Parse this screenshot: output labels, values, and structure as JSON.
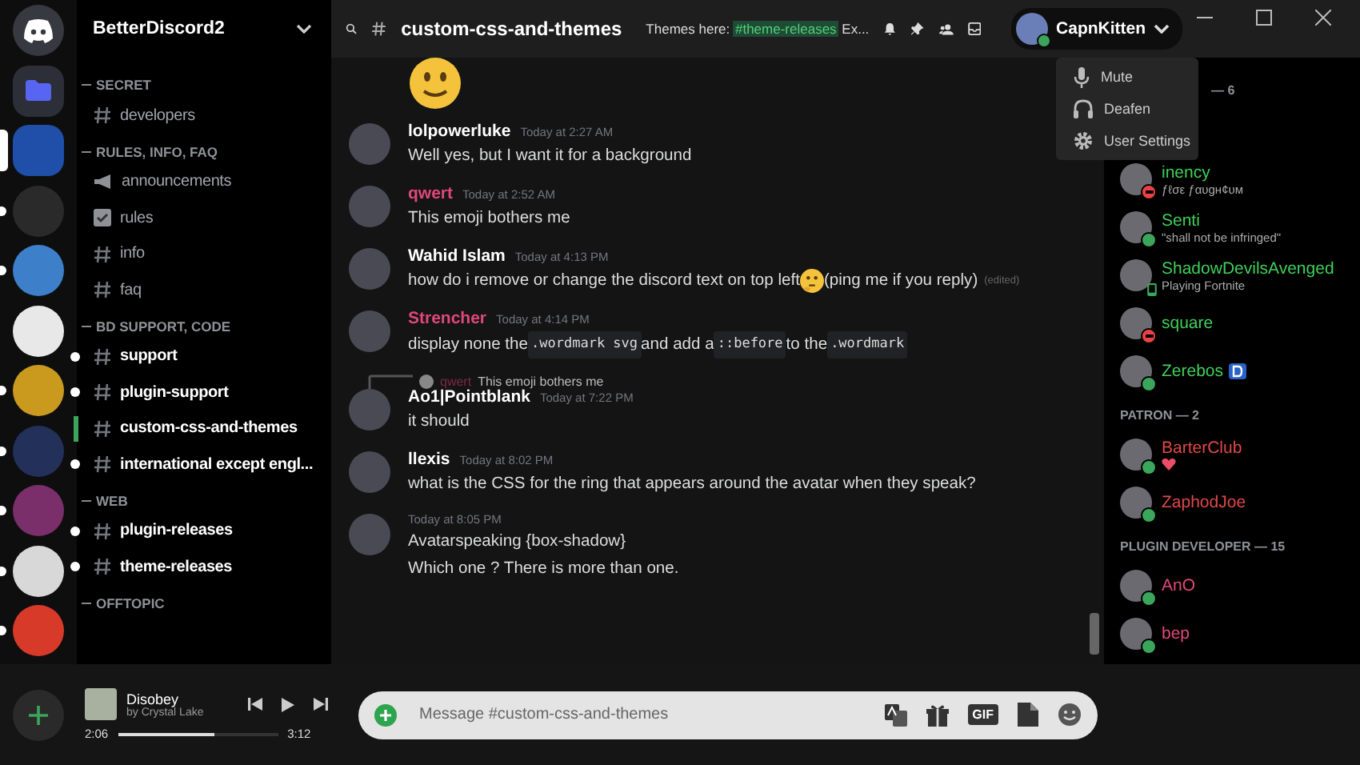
{
  "servers": [
    {
      "kind": "home",
      "selected": false,
      "unread": false
    },
    {
      "kind": "folder",
      "selected": false,
      "unread": false
    },
    {
      "kind": "server",
      "color": "#1f4fa8",
      "selected": true,
      "unread": false
    },
    {
      "kind": "server",
      "color": "#2a2a2a",
      "selected": false,
      "unread": true
    },
    {
      "kind": "server",
      "color": "#3d7fc9",
      "selected": false,
      "unread": true
    },
    {
      "kind": "server",
      "color": "#e8e8e8",
      "selected": false,
      "unread": false
    },
    {
      "kind": "server",
      "color": "#c99a1e",
      "selected": false,
      "unread": true
    },
    {
      "kind": "server",
      "color": "#22305a",
      "selected": false,
      "unread": true
    },
    {
      "kind": "server",
      "color": "#7a2e6a",
      "selected": false,
      "unread": true
    },
    {
      "kind": "server",
      "color": "#d8d8d8",
      "selected": false,
      "unread": true
    },
    {
      "kind": "server",
      "color": "#d83a2a",
      "selected": false,
      "unread": true
    }
  ],
  "guild": {
    "name": "BetterDiscord2"
  },
  "categories": [
    {
      "name": "SECRET",
      "channels": [
        {
          "name": "developers",
          "kind": "text",
          "unread": false,
          "selected": false
        }
      ]
    },
    {
      "name": "RULES, INFO, FAQ",
      "channels": [
        {
          "name": "announcements",
          "kind": "announcement",
          "unread": false,
          "selected": false
        },
        {
          "name": "rules",
          "kind": "rules",
          "unread": false,
          "selected": false
        },
        {
          "name": "info",
          "kind": "text",
          "unread": false,
          "selected": false
        },
        {
          "name": "faq",
          "kind": "text",
          "unread": false,
          "selected": false
        }
      ]
    },
    {
      "name": "BD SUPPORT, CODE",
      "channels": [
        {
          "name": "support",
          "kind": "text",
          "unread": true,
          "selected": false
        },
        {
          "name": "plugin-support",
          "kind": "text",
          "unread": true,
          "selected": false
        },
        {
          "name": "custom-css-and-themes",
          "kind": "text",
          "unread": false,
          "selected": true
        },
        {
          "name": "international except engl...",
          "kind": "text",
          "unread": true,
          "selected": false
        }
      ]
    },
    {
      "name": "WEB",
      "channels": [
        {
          "name": "plugin-releases",
          "kind": "text",
          "unread": true,
          "selected": false
        },
        {
          "name": "theme-releases",
          "kind": "text",
          "unread": true,
          "selected": false
        }
      ]
    },
    {
      "name": "OFFTOPIC"
    }
  ],
  "header": {
    "channel": "custom-css-and-themes",
    "topic_prefix": "Themes here:",
    "topic_mention": "#theme-releases",
    "topic_suffix": "Ex..."
  },
  "user": {
    "name": "CapnKitten"
  },
  "user_menu": [
    {
      "label": "Mute",
      "kind": "mic"
    },
    {
      "label": "Deafen",
      "kind": "headphones"
    },
    {
      "label": "User Settings",
      "kind": "gear"
    }
  ],
  "messages": [
    {
      "kind": "jumbo"
    },
    {
      "kind": "message",
      "author": "lolpowerluke",
      "color": "#ffffff",
      "time": "Today at 2:27 AM",
      "lines": [
        [
          {
            "kind": "text",
            "text": "Well yes, but I want it for a background"
          }
        ]
      ]
    },
    {
      "kind": "message",
      "author": "qwert",
      "color": "#e0487a",
      "time": "Today at 2:52 AM",
      "lines": [
        [
          {
            "kind": "text",
            "text": "This emoji bothers me"
          }
        ]
      ]
    },
    {
      "kind": "message",
      "author": "Wahid Islam",
      "color": "#ffffff",
      "time": "Today at 4:13 PM",
      "lines": [
        [
          {
            "kind": "text",
            "text": "how do i remove or change the discord text on top left "
          },
          {
            "kind": "emoji"
          },
          {
            "kind": "text",
            "text": "(ping me if you reply)"
          },
          {
            "kind": "edited",
            "text": "(edited)"
          }
        ]
      ]
    },
    {
      "kind": "message",
      "author": "Strencher",
      "color": "#e0487a",
      "time": "Today at 4:14 PM",
      "lines": [
        [
          {
            "kind": "text",
            "text": "display none the "
          },
          {
            "kind": "code",
            "text": ".wordmark svg"
          },
          {
            "kind": "text",
            "text": " and add a "
          },
          {
            "kind": "code",
            "text": "::before"
          },
          {
            "kind": "text",
            "text": " to the "
          },
          {
            "kind": "code",
            "text": ".wordmark"
          }
        ]
      ]
    },
    {
      "kind": "message",
      "author": "Ao1|Pointblank",
      "color": "#ffffff",
      "time": "Today at 7:22 PM",
      "reply": {
        "author": "qwert",
        "text": "This emoji bothers me"
      },
      "lines": [
        [
          {
            "kind": "text",
            "text": "it should"
          }
        ]
      ]
    },
    {
      "kind": "message",
      "author": "llexis",
      "color": "#ffffff",
      "time": "Today at 8:02 PM",
      "lines": [
        [
          {
            "kind": "text",
            "text": "what is the CSS for the ring that appears around the avatar when they speak?"
          }
        ]
      ]
    },
    {
      "kind": "message",
      "time": "Today at 8:05 PM",
      "lines": [
        [
          {
            "kind": "text",
            "text": "Avatarspeaking {box-shadow}"
          }
        ],
        [
          {
            "kind": "text",
            "text": "Which one ?  There is more than one."
          }
        ]
      ]
    }
  ],
  "member_groups": [
    {
      "title": "— 6",
      "color": "#3fcf5a",
      "members": [
        {
          "name": "inency",
          "kind": "dnd",
          "activity": "ƒℓσε ƒαυgн¢υм"
        },
        {
          "name": "Senti",
          "kind": "online",
          "activity": "\"shall not be infringed\""
        },
        {
          "name": "ShadowDevilsAvenged",
          "kind": "mobile",
          "activity": "Playing Fortnite"
        },
        {
          "name": "square",
          "kind": "dnd"
        },
        {
          "name": "Zerebos",
          "kind": "online",
          "badge": true
        }
      ]
    },
    {
      "title": "PATRON — 2",
      "color": "#e04848",
      "members": [
        {
          "name": "BarterClub",
          "kind": "online",
          "heart": true
        },
        {
          "name": "ZaphodJoe",
          "kind": "online"
        }
      ]
    },
    {
      "title": "PLUGIN DEVELOPER — 15",
      "color": "#e0487a",
      "members": [
        {
          "name": "AnO",
          "kind": "online"
        },
        {
          "name": "bep",
          "kind": "online"
        }
      ]
    }
  ],
  "player": {
    "title": "Disobey",
    "artist": "by Crystal Lake",
    "elapsed": "2:06",
    "duration": "3:12",
    "level": 0.6
  },
  "composer": {
    "placeholder": "Message #custom-css-and-themes",
    "gif": "GIF"
  }
}
